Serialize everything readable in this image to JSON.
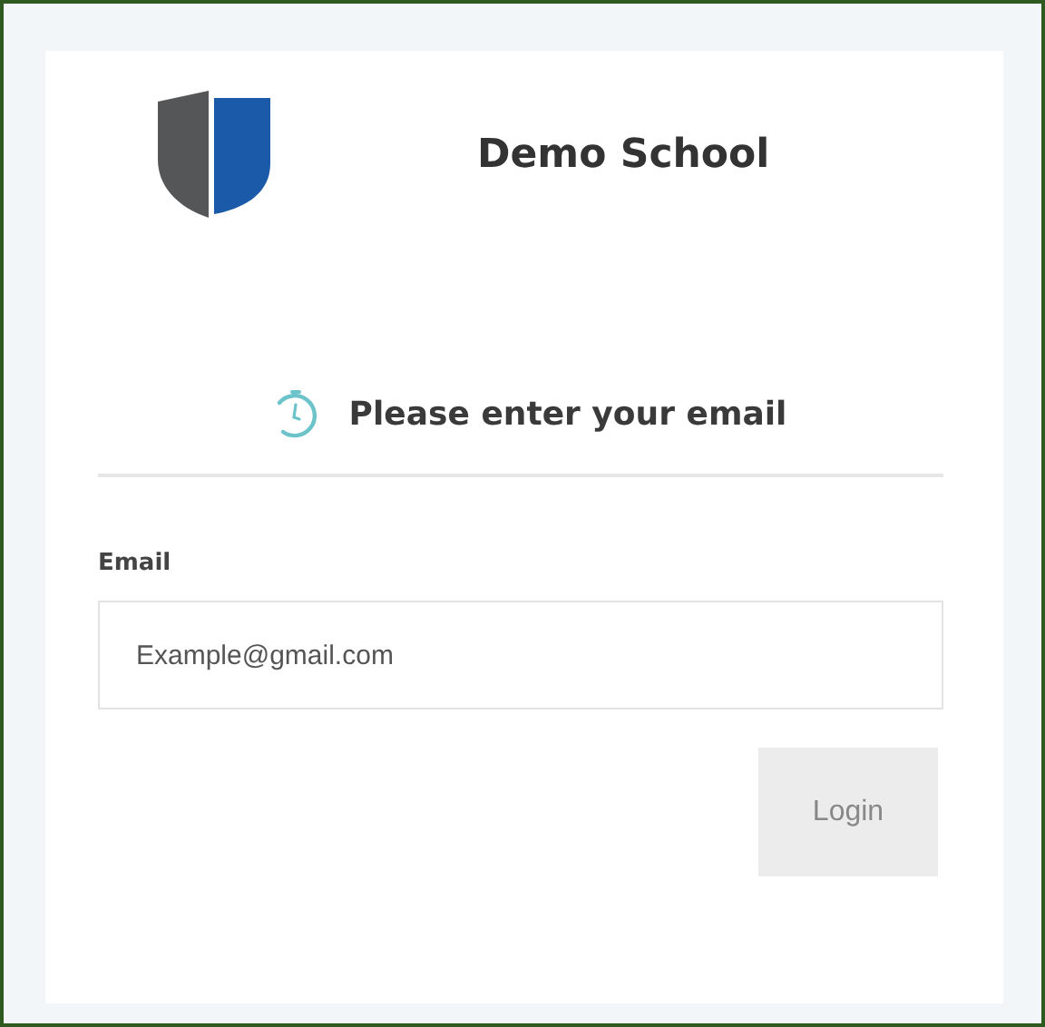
{
  "school_name": "Demo School",
  "heading": "Please enter your email",
  "email_field": {
    "label": "Email",
    "placeholder": "Example@gmail.com"
  },
  "login_button": {
    "label": "Login",
    "disabled": true
  }
}
